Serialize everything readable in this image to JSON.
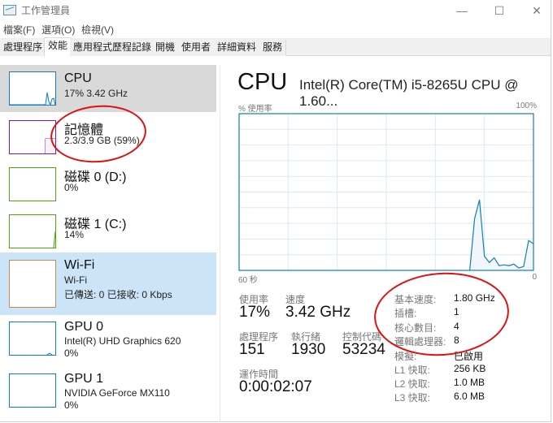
{
  "window": {
    "title": "工作管理員",
    "controls": {
      "minimize": "—",
      "maximize": "☐",
      "close": "✕"
    }
  },
  "menubar": {
    "items": [
      "檔案(F)",
      "選項(O)",
      "檢視(V)"
    ]
  },
  "tabs": [
    {
      "label": "處理程序",
      "active": false
    },
    {
      "label": "效能",
      "active": true
    },
    {
      "label": "應用程式歷程記錄",
      "active": false
    },
    {
      "label": "開機",
      "active": false
    },
    {
      "label": "使用者",
      "active": false
    },
    {
      "label": "詳細資料",
      "active": false
    },
    {
      "label": "服務",
      "active": false
    }
  ],
  "sidebar": {
    "items": [
      {
        "name": "CPU",
        "line1": "17% 3.42 GHz",
        "line2": "",
        "color": "#117dbb",
        "selected": "gray"
      },
      {
        "name": "記憶體",
        "line1": "2.3/3.9 GB (59%)",
        "line2": "",
        "color": "#8b12ae",
        "selected": ""
      },
      {
        "name": "磁碟 0 (D:)",
        "line1": "0%",
        "line2": "",
        "color": "#4da60c",
        "selected": ""
      },
      {
        "name": "磁碟 1 (C:)",
        "line1": "14%",
        "line2": "",
        "color": "#4da60c",
        "selected": ""
      },
      {
        "name": "Wi-Fi",
        "line1": "Wi-Fi",
        "line2": "已傳送: 0 已接收: 0 Kbps",
        "color": "#a74f01",
        "selected": "blue"
      },
      {
        "name": "GPU 0",
        "line1": "Intel(R) UHD Graphics 620",
        "line2": "0%",
        "color": "#117dbb",
        "selected": ""
      },
      {
        "name": "GPU 1",
        "line1": "NVIDIA GeForce MX110",
        "line2": "0%",
        "color": "#117dbb",
        "selected": ""
      }
    ]
  },
  "detail": {
    "title": "CPU",
    "model": "Intel(R) Core(TM) i5-8265U CPU @ 1.60...",
    "chart_top_left": "% 使用率",
    "chart_top_right": "100%",
    "chart_bottom_left": "60 秒",
    "chart_bottom_right": "0",
    "stats": {
      "utilization_label": "使用率",
      "utilization": "17%",
      "speed_label": "速度",
      "speed": "3.42 GHz",
      "processes_label": "處理程序",
      "processes": "151",
      "threads_label": "執行緒",
      "threads": "1930",
      "handles_label": "控制代碼",
      "handles": "53234",
      "uptime_label": "運作時間",
      "uptime": "0:00:02:07"
    },
    "specs": [
      {
        "label": "基本速度:",
        "value": "1.80 GHz"
      },
      {
        "label": "插槽:",
        "value": "1"
      },
      {
        "label": "核心數目:",
        "value": "4"
      },
      {
        "label": "邏輯處理器:",
        "value": "8"
      },
      {
        "label": "模擬:",
        "value": "已啟用"
      },
      {
        "label": "L1 快取:",
        "value": "256 KB"
      },
      {
        "label": "L2 快取:",
        "value": "1.0 MB"
      },
      {
        "label": "L3 快取:",
        "value": "6.0 MB"
      }
    ]
  },
  "colors": {
    "cpu_line": "#117dbb",
    "cpu_fill": "#f1f6fa",
    "grid": "#d9eaf4",
    "annotation": "#e01010"
  },
  "chart_data": {
    "type": "area",
    "title": "% 使用率",
    "xlabel": "60 秒",
    "ylabel": "% 使用率",
    "xlim": [
      60,
      0
    ],
    "ylim": [
      0,
      100
    ],
    "grid": true,
    "x_seconds_ago": [
      60,
      59,
      58,
      57,
      56,
      55,
      54,
      53,
      52,
      51,
      50,
      49,
      48,
      47,
      46,
      45,
      44,
      43,
      42,
      41,
      40,
      39,
      38,
      37,
      36,
      35,
      34,
      33,
      32,
      31,
      30,
      29,
      28,
      27,
      26,
      25,
      24,
      23,
      22,
      21,
      20,
      19,
      18,
      17,
      16,
      15,
      14,
      13,
      12,
      11,
      10,
      9,
      8,
      7,
      6,
      5,
      4,
      3,
      2,
      1,
      0
    ],
    "series": [
      {
        "name": "CPU 使用率",
        "values": [
          0,
          0,
          0,
          0,
          0,
          0,
          0,
          0,
          0,
          0,
          0,
          0,
          0,
          0,
          0,
          0,
          0,
          0,
          0,
          0,
          0,
          0,
          0,
          0,
          0,
          0,
          0,
          0,
          0,
          0,
          0,
          0,
          0,
          0,
          0,
          0,
          0,
          0,
          0,
          0,
          0,
          0,
          0,
          0,
          0,
          0,
          0,
          0,
          33,
          45,
          9,
          5,
          8,
          3,
          3.5,
          3,
          4,
          1.5,
          2.5,
          19,
          17
        ]
      }
    ]
  }
}
